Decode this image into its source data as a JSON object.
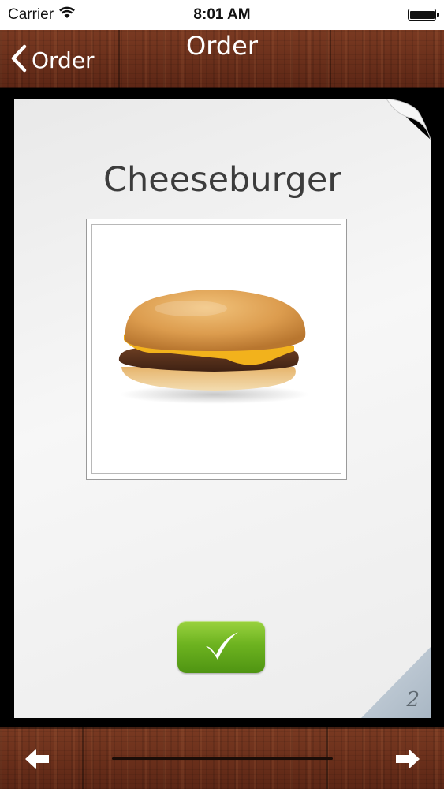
{
  "status_bar": {
    "carrier": "Carrier",
    "time": "8:01 AM",
    "icons": [
      "wifi-icon",
      "battery-icon"
    ]
  },
  "nav": {
    "back_label": "Order",
    "title": "Order",
    "icons": [
      "chevron-left-icon"
    ]
  },
  "card": {
    "title": "Cheeseburger",
    "image": "cheeseburger-photo",
    "confirm_icon": "checkmark-icon",
    "page_number": "2"
  },
  "toolbar": {
    "icons": [
      "arrow-left-icon",
      "arrow-right-icon"
    ]
  },
  "colors": {
    "wood": "#6b2f1a",
    "confirm_green": "#6db320",
    "card_background": "#f2f2f2",
    "title_text": "#3c3c3c"
  }
}
